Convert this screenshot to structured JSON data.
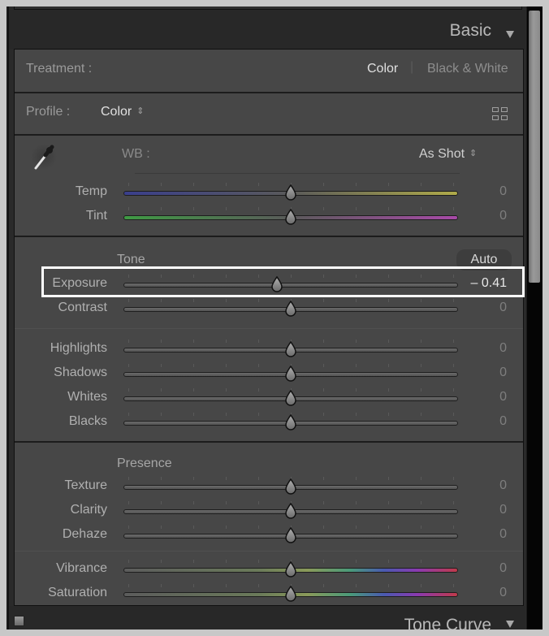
{
  "panel": {
    "title": "Basic",
    "collapse_icon": "triangle-down-icon"
  },
  "treatment": {
    "label": "Treatment :",
    "options": [
      "Color",
      "Black & White"
    ],
    "selected": "Color",
    "separator": "|"
  },
  "profile": {
    "label": "Profile :",
    "value": "Color",
    "browser_icon": "grid-icon"
  },
  "white_balance": {
    "picker_icon": "eyedropper-icon",
    "label": "WB :",
    "value": "As Shot",
    "sliders": [
      {
        "name": "temp",
        "label": "Temp",
        "value": 0,
        "display": "0",
        "gradient": [
          "#3a3f8c",
          "#5a5a5a",
          "#b0ab4a"
        ]
      },
      {
        "name": "tint",
        "label": "Tint",
        "value": 0,
        "display": "0",
        "gradient": [
          "#3f9a44",
          "#5a5a5a",
          "#a84aa8"
        ]
      }
    ]
  },
  "tone": {
    "heading": "Tone",
    "auto_label": "Auto",
    "sliders_a": [
      {
        "name": "exposure",
        "label": "Exposure",
        "value": -0.41,
        "min": -5,
        "max": 5,
        "display": "– 0.41",
        "active": true
      },
      {
        "name": "contrast",
        "label": "Contrast",
        "value": 0,
        "min": -100,
        "max": 100,
        "display": "0"
      }
    ],
    "sliders_b": [
      {
        "name": "highlights",
        "label": "Highlights",
        "value": 0,
        "min": -100,
        "max": 100,
        "display": "0"
      },
      {
        "name": "shadows",
        "label": "Shadows",
        "value": 0,
        "min": -100,
        "max": 100,
        "display": "0"
      },
      {
        "name": "whites",
        "label": "Whites",
        "value": 0,
        "min": -100,
        "max": 100,
        "display": "0"
      },
      {
        "name": "blacks",
        "label": "Blacks",
        "value": 0,
        "min": -100,
        "max": 100,
        "display": "0"
      }
    ]
  },
  "presence": {
    "heading": "Presence",
    "sliders_a": [
      {
        "name": "texture",
        "label": "Texture",
        "value": 0,
        "min": -100,
        "max": 100,
        "display": "0"
      },
      {
        "name": "clarity",
        "label": "Clarity",
        "value": 0,
        "min": -100,
        "max": 100,
        "display": "0"
      },
      {
        "name": "dehaze",
        "label": "Dehaze",
        "value": 0,
        "min": -100,
        "max": 100,
        "display": "0"
      }
    ],
    "sliders_b": [
      {
        "name": "vibrance",
        "label": "Vibrance",
        "value": 0,
        "min": -100,
        "max": 100,
        "display": "0",
        "spectrum": true
      },
      {
        "name": "saturation",
        "label": "Saturation",
        "value": 0,
        "min": -100,
        "max": 100,
        "display": "0",
        "spectrum": true
      }
    ]
  },
  "next_panel": {
    "title": "Tone Curve",
    "collapse_icon": "triangle-down-icon"
  },
  "colors": {
    "panel_bg": "#474747",
    "header_bg": "#282828",
    "highlight_border": "#ffffff",
    "active_text": "#e8e8e8",
    "inactive_text": "#8e8e8e"
  }
}
